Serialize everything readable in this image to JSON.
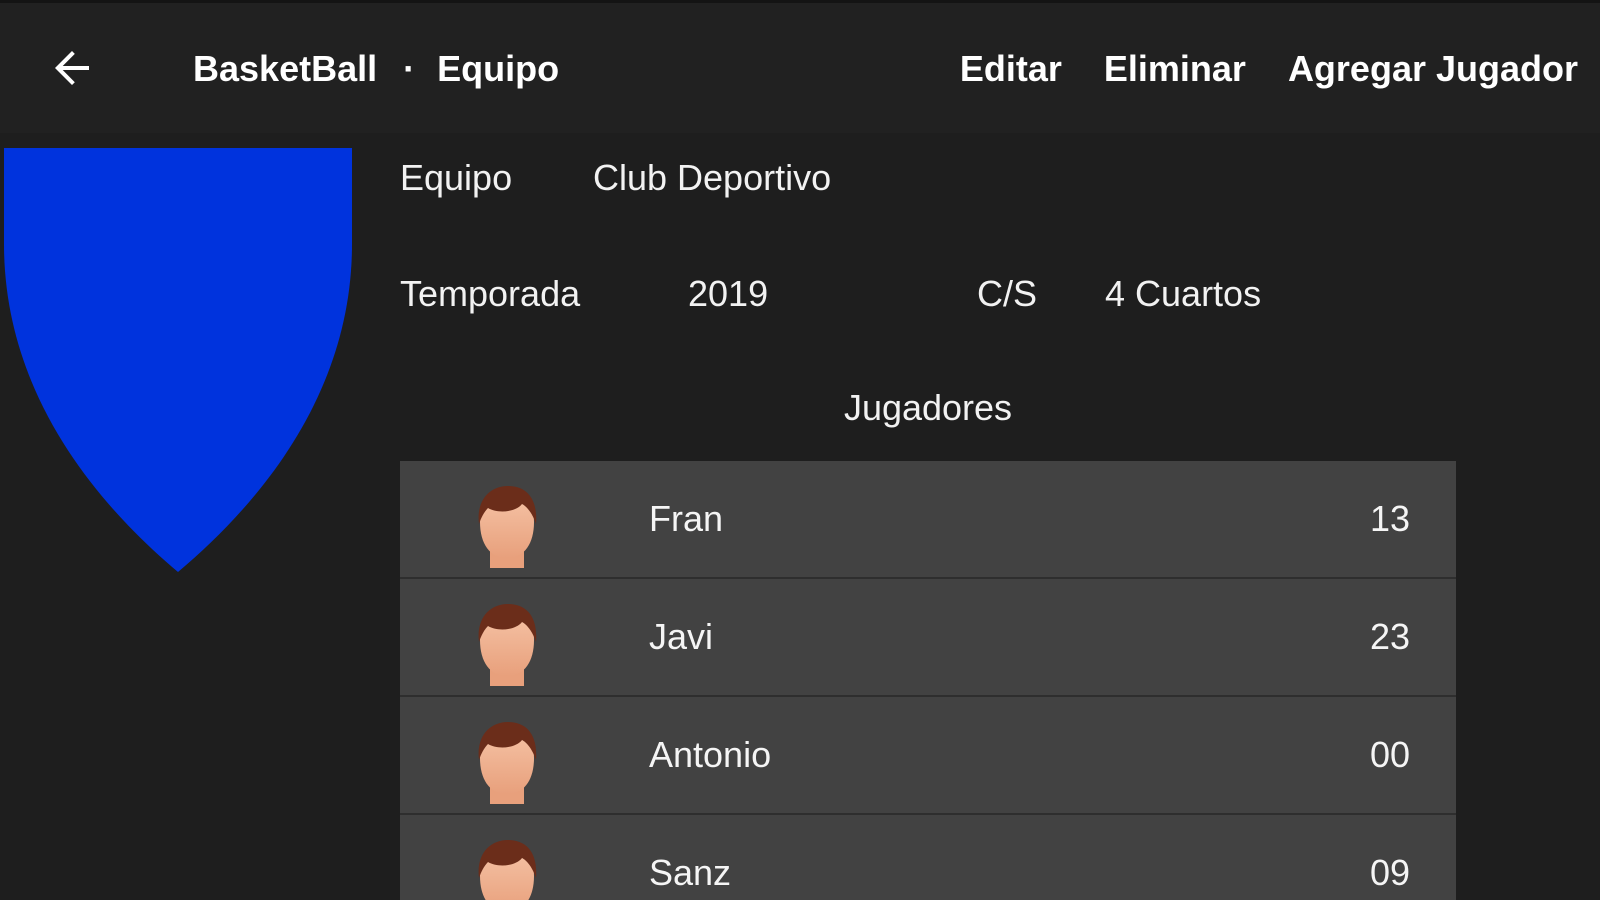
{
  "appbar": {
    "back_icon": "arrow-left-icon",
    "app_name": "BasketBall",
    "separator": "·",
    "screen_name": "Equipo",
    "actions": {
      "edit": "Editar",
      "delete": "Eliminar",
      "add_player": "Agregar Jugador"
    }
  },
  "team": {
    "crest_icon": "shield-icon",
    "crest_color": "#0033dd",
    "team_label": "Equipo",
    "team_value": "Club Deportivo",
    "season_label": "Temporada",
    "season_value": "2019",
    "cs_label": "C/S",
    "cs_value": "4 Cuartos"
  },
  "players_section": {
    "title": "Jugadores",
    "avatar_icon": "person-avatar-icon",
    "items": [
      {
        "name": "Fran",
        "number": "13"
      },
      {
        "name": "Javi",
        "number": "23"
      },
      {
        "name": "Antonio",
        "number": "00"
      },
      {
        "name": "Sanz",
        "number": "09"
      }
    ]
  }
}
